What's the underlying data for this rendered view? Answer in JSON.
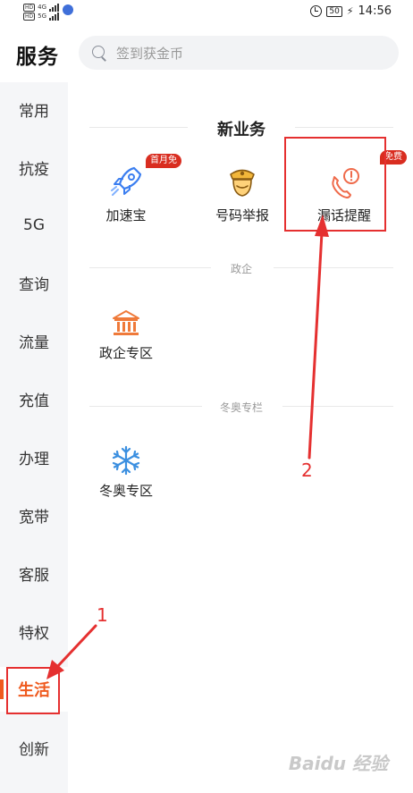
{
  "status_bar": {
    "network_a": "4G",
    "network_b": "5G",
    "battery": "50",
    "time": "14:56"
  },
  "header": {
    "title": "服务",
    "search_placeholder": "签到获金币"
  },
  "sidebar": {
    "items": [
      {
        "label": "常用"
      },
      {
        "label": "抗疫"
      },
      {
        "label": "5G"
      },
      {
        "label": "查询"
      },
      {
        "label": "流量"
      },
      {
        "label": "充值"
      },
      {
        "label": "办理"
      },
      {
        "label": "宽带"
      },
      {
        "label": "客服"
      },
      {
        "label": "特权"
      },
      {
        "label": "生活",
        "active": true
      },
      {
        "label": "创新"
      }
    ]
  },
  "sections": {
    "new_business": {
      "title": "新业务",
      "items": [
        {
          "label": "加速宝",
          "icon": "rocket-icon",
          "badge": "首月免"
        },
        {
          "label": "号码举报",
          "icon": "police-officer-icon"
        },
        {
          "label": "漏话提醒",
          "icon": "missed-call-icon",
          "badge": "免费"
        }
      ]
    },
    "government": {
      "title": "政企",
      "items": [
        {
          "label": "政企专区",
          "icon": "government-building-icon"
        }
      ]
    },
    "winter_olympics": {
      "title": "冬奥专栏",
      "items": [
        {
          "label": "冬奥专区",
          "icon": "snowflake-icon"
        }
      ]
    }
  },
  "annotations": {
    "step_1": "1",
    "step_2": "2"
  },
  "colors": {
    "accent": "#ef5a1e",
    "badge": "#d92d20",
    "annotation": "#e53030"
  }
}
